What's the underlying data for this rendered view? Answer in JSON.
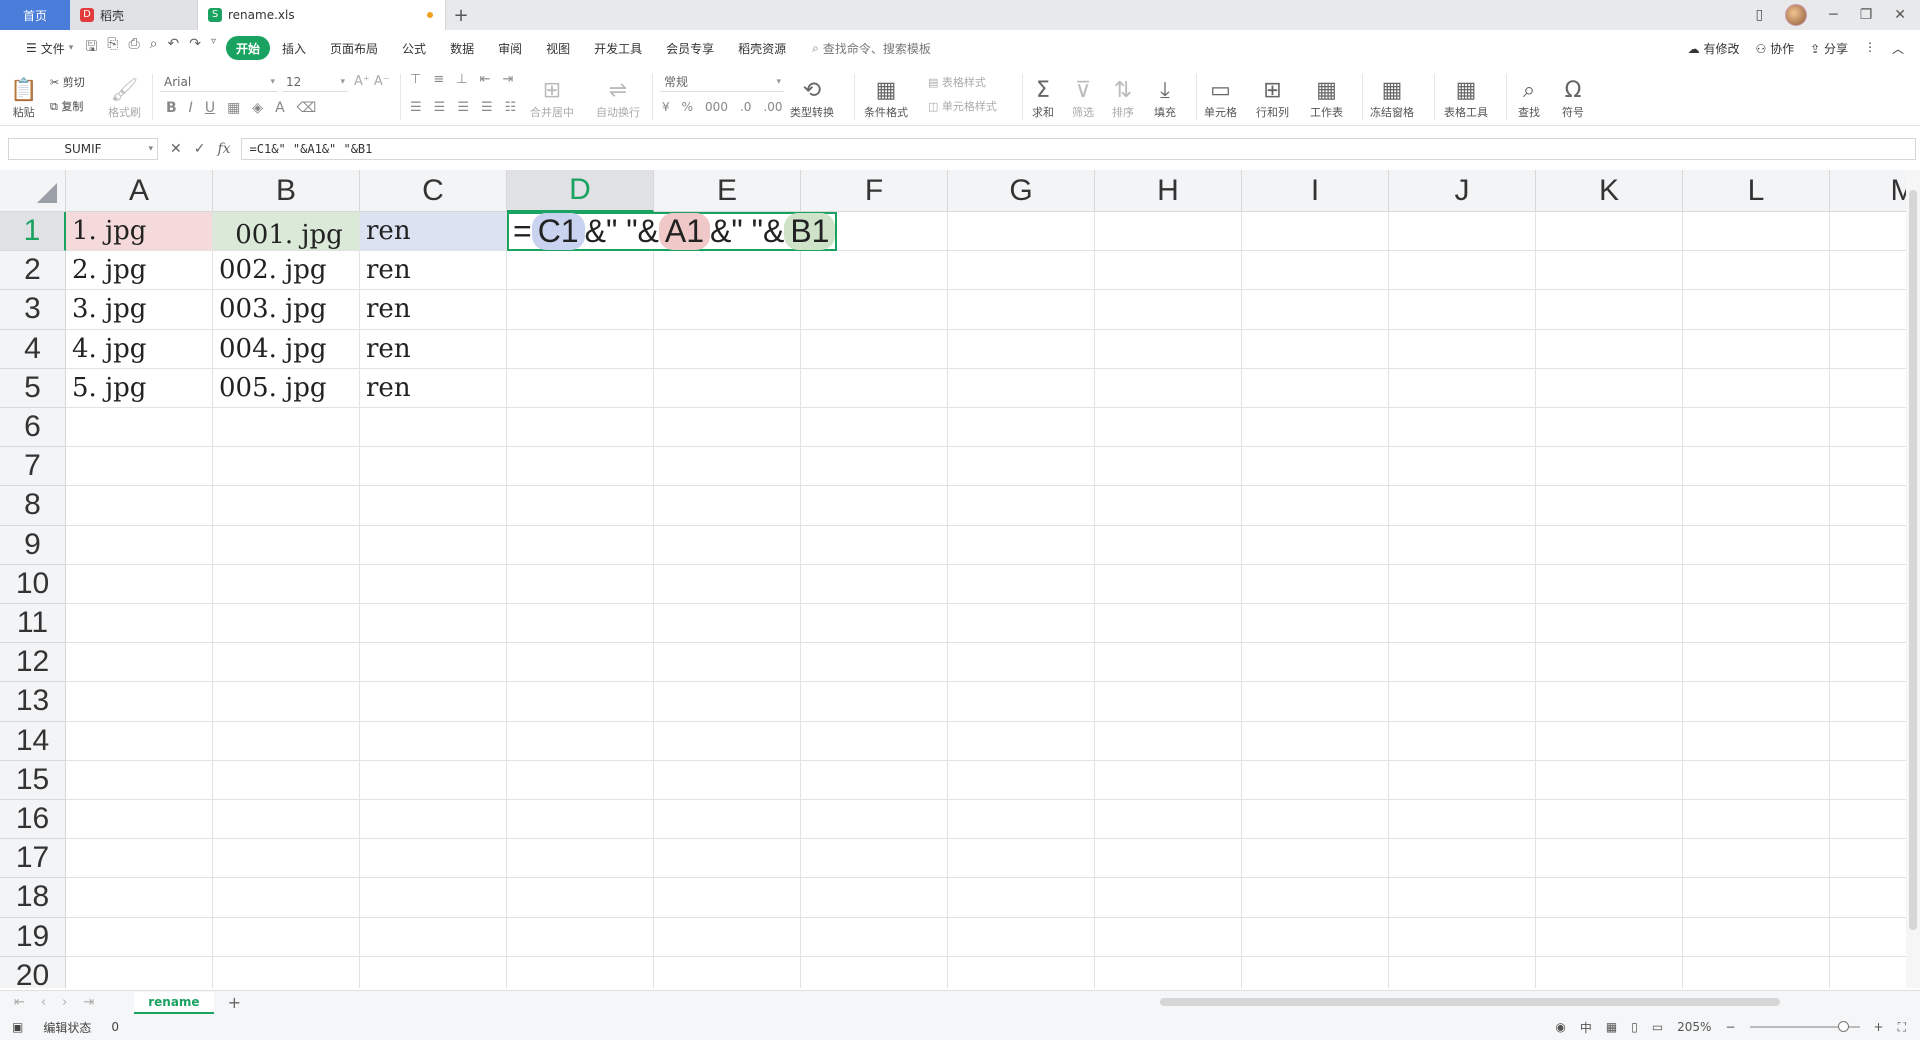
{
  "tabs": {
    "home": "首页",
    "docer": "稻壳",
    "file": "rename.xls"
  },
  "menu": {
    "file": "文件",
    "items": [
      "开始",
      "插入",
      "页面布局",
      "公式",
      "数据",
      "审阅",
      "视图",
      "开发工具",
      "会员专享",
      "稻壳资源"
    ],
    "search_placeholder": "查找命令、搜索模板",
    "has_changes": "有修改",
    "collaborate": "协作",
    "share": "分享"
  },
  "ribbon": {
    "paste": "粘贴",
    "cut": "剪切",
    "copy": "复制",
    "format_painter": "格式刷",
    "font_name": "Arial",
    "font_size": "12",
    "merge_center": "合并居中",
    "wrap_text": "自动换行",
    "number_format": "常规",
    "type_convert": "类型转换",
    "conditional_format": "条件格式",
    "table_style": "表格样式",
    "cell_style": "单元格样式",
    "sum": "求和",
    "filter": "筛选",
    "sort": "排序",
    "fill": "填充",
    "cell": "单元格",
    "row_col": "行和列",
    "worksheet": "工作表",
    "freeze": "冻结窗格",
    "table_tools": "表格工具",
    "find": "查找",
    "symbol": "符号"
  },
  "formula_bar": {
    "name_box": "SUMIF",
    "formula": "=C1&\" \"&A1&\" \"&B1"
  },
  "columns": [
    "A",
    "B",
    "C",
    "D",
    "E",
    "F",
    "G",
    "H",
    "I",
    "J",
    "K",
    "L",
    "M"
  ],
  "rows": [
    "1",
    "2",
    "3",
    "4",
    "5",
    "6",
    "7",
    "8",
    "9",
    "10",
    "11",
    "12",
    "13",
    "14",
    "15",
    "16",
    "17",
    "18",
    "19",
    "20"
  ],
  "cells": {
    "A": [
      "1. jpg",
      "2. jpg",
      "3. jpg",
      "4. jpg",
      "5. jpg"
    ],
    "B": [
      "001. jpg",
      "002. jpg",
      "003. jpg",
      "004. jpg",
      "005. jpg"
    ],
    "C": [
      "ren",
      "ren",
      "ren",
      "ren",
      "ren"
    ]
  },
  "editing": {
    "eq": "=",
    "ref1": "C1",
    "sep1": "&\" \"&",
    "ref2": "A1",
    "sep2": "&\" \"&",
    "ref3": "B1"
  },
  "sheets": [
    "rename"
  ],
  "status": {
    "mode": "编辑状态",
    "value": "0",
    "zoom": "205%"
  },
  "colors": {
    "accent": "#1aa260",
    "ref_c": "#c9d3ef",
    "ref_a": "#f0c8c8",
    "ref_b": "#cfe3c9"
  }
}
